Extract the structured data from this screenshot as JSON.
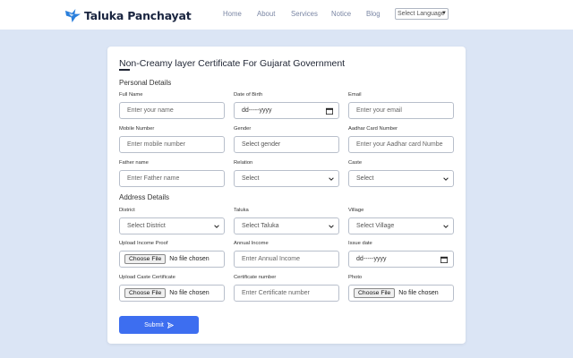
{
  "brand": {
    "name": "Taluka Panchayat"
  },
  "nav": {
    "links": [
      "Home",
      "About",
      "Services",
      "Notice",
      "Blog"
    ],
    "language": "Select Language"
  },
  "form": {
    "title": "Non-Creamy layer Certificate For Gujarat Government",
    "personal_title": "Personal Details",
    "address_title": "Address Details",
    "fields": {
      "full_name": {
        "label": "Full Name",
        "placeholder": "Enter your name"
      },
      "dob": {
        "label": "Date of Birth",
        "placeholder": "dd-----yyyy"
      },
      "email": {
        "label": "Email",
        "placeholder": "Enter your email"
      },
      "mobile": {
        "label": "Mobile Number",
        "placeholder": "Enter mobile number"
      },
      "gender": {
        "label": "Gender",
        "value": "Select gender"
      },
      "aadhar": {
        "label": "Aadhar Card Number",
        "placeholder": "Enter your Aadhar card Numbe"
      },
      "father": {
        "label": "Father name",
        "placeholder": "Enter Father name"
      },
      "relation": {
        "label": "Relation",
        "value": "Select"
      },
      "caste": {
        "label": "Caste",
        "value": "Select"
      },
      "district": {
        "label": "District",
        "value": "Select District"
      },
      "taluka": {
        "label": "Taluka",
        "value": "Select Taluka"
      },
      "village": {
        "label": "Village",
        "value": "Select Village"
      },
      "income_proof": {
        "label": "Upload Income Proof",
        "button": "Choose File",
        "status": "No file chosen"
      },
      "annual_income": {
        "label": "Annual Income",
        "placeholder": "Enter Annual Income"
      },
      "issue_date": {
        "label": "Issue date",
        "placeholder": "dd-----yyyy"
      },
      "caste_cert": {
        "label": "Upload Caste Certificate",
        "button": "Choose File",
        "status": "No file chosen"
      },
      "cert_number": {
        "label": "Certificate number",
        "placeholder": "Enter Certificate number"
      },
      "photo": {
        "label": "Photo",
        "button": "Choose File",
        "status": "No file chosen"
      }
    },
    "submit_label": "Submit"
  },
  "colors": {
    "accent": "#3d6ef0",
    "page_bg": "#dbe5f5",
    "brand_icon": "#2a7fdc"
  },
  "icons": [
    "bird-logo-icon",
    "chevron-down-icon",
    "calendar-icon",
    "send-icon"
  ]
}
